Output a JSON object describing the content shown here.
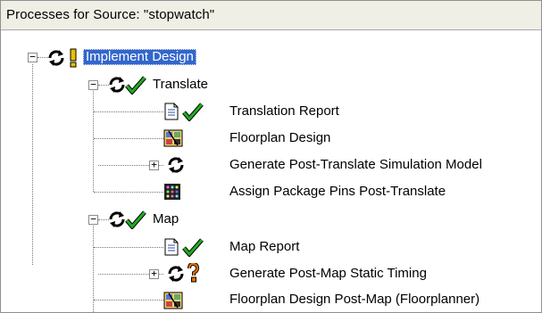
{
  "header": {
    "title": "Processes for Source:  \"stopwatch\""
  },
  "tree": {
    "implement": {
      "label": "Implement Design",
      "expander": "−"
    },
    "translate": {
      "label": "Translate",
      "expander": "−"
    },
    "translation_report": {
      "label": "Translation Report"
    },
    "floorplan_design": {
      "label": "Floorplan Design"
    },
    "gen_post_translate": {
      "label": "Generate Post-Translate Simulation Model",
      "expander": "+"
    },
    "assign_pins": {
      "label": "Assign Package Pins Post-Translate"
    },
    "map": {
      "label": "Map",
      "expander": "−"
    },
    "map_report": {
      "label": "Map Report"
    },
    "gen_post_map": {
      "label": "Generate Post-Map Static Timing",
      "expander": "+"
    },
    "floorplan_post_map": {
      "label": "Floorplan Design Post-Map (Floorplanner)"
    }
  },
  "colors": {
    "selection": "#3366cc",
    "header_bg": "#efefe6",
    "check": "#22aa22",
    "warning": "#e8c000",
    "question": "#e07000"
  }
}
